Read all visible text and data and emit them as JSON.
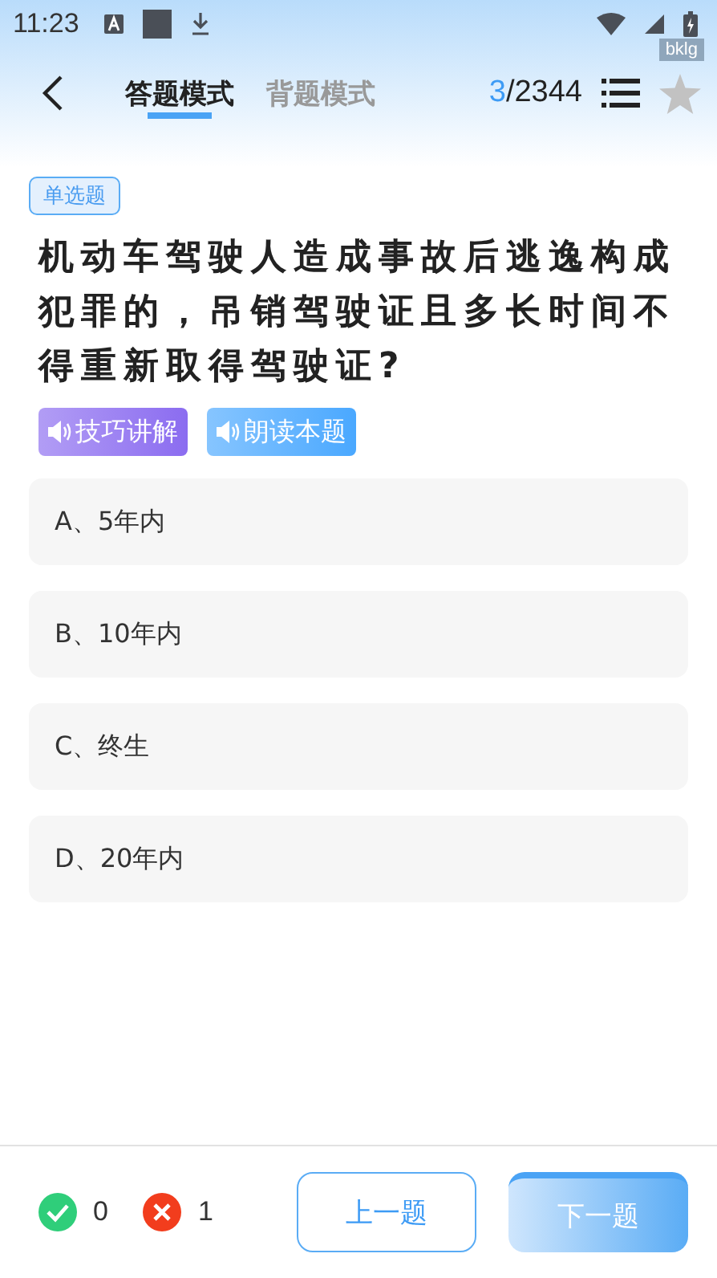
{
  "status_bar": {
    "time": "11:23"
  },
  "header": {
    "tabs": [
      {
        "label": "答题模式",
        "selected": true
      },
      {
        "label": "背题模式",
        "selected": false
      }
    ],
    "current": "3",
    "total": "/2344",
    "tag": "bklg",
    "favorited": false
  },
  "question": {
    "type": "单选题",
    "text": "机动车驾驶人造成事故后逃逸构成犯罪的，吊销驾驶证且多长时间不得重新取得驾驶证?",
    "actions": [
      {
        "label": "技巧讲解",
        "color": "#8b6cf0"
      },
      {
        "label": "朗读本题",
        "color": "#4aa8ff"
      }
    ],
    "options": [
      {
        "label": "A、5年内"
      },
      {
        "label": "B、10年内"
      },
      {
        "label": "C、终生"
      },
      {
        "label": "D、20年内"
      }
    ]
  },
  "footer": {
    "correct": "0",
    "wrong": "1",
    "prev": "上一题",
    "next": "下一题"
  }
}
